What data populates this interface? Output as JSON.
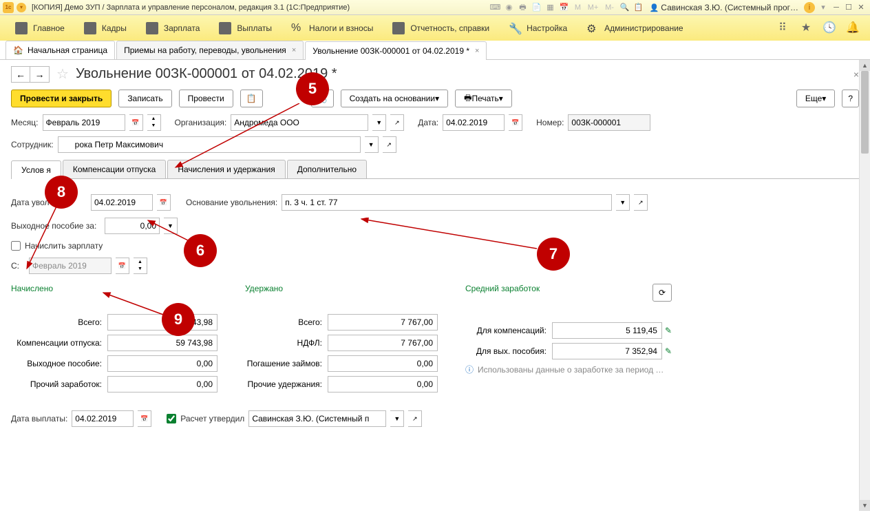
{
  "titlebar": {
    "title": "[КОПИЯ] Демо ЗУП / Зарплата и управление персоналом, редакция 3.1  (1С:Предприятие)",
    "user": "Савинская З.Ю. (Системный прог…",
    "m": "M",
    "mplus": "M+",
    "mminus": "M-"
  },
  "nav": {
    "items": [
      "Главное",
      "Кадры",
      "Зарплата",
      "Выплаты",
      "Налоги и взносы",
      "Отчетность, справки",
      "Настройка",
      "Администрирование"
    ]
  },
  "tabs": {
    "home": "Начальная страница",
    "t1": "Приемы на работу, переводы, увольнения",
    "t2": "Увольнение 00ЗК-000001 от 04.02.2019 *"
  },
  "page": {
    "title": "Увольнение 00ЗК-000001 от 04.02.2019 *"
  },
  "toolbar": {
    "post_close": "Провести и закрыть",
    "save": "Записать",
    "post": "Провести",
    "create_on": "Создать на основании",
    "print": "Печать",
    "more": "Еще"
  },
  "fields": {
    "month_lbl": "Месяц:",
    "month": "Февраль 2019",
    "org_lbl": "Организация:",
    "org": "Андромеда ООО",
    "date_lbl": "Дата:",
    "date": "04.02.2019",
    "num_lbl": "Номер:",
    "num": "00ЗК-000001",
    "emp_lbl": "Сотрудник:",
    "emp": "      рока Петр Максимович"
  },
  "dtabs": {
    "t1": "Услов               я",
    "t2": "Компенсации отпуска",
    "t3": "Начисления и удержания",
    "t4": "Дополнительно"
  },
  "panel": {
    "dismiss_date_lbl": "Дата увол         ия:",
    "dismiss_date": "04.02.2019",
    "reason_lbl": "Основание увольнения:",
    "reason": "п. 3 ч. 1 ст. 77",
    "sev_lbl": "Выходное пособие за:",
    "sev": "0,00",
    "accrue_lbl": "Начислить зарплату",
    "from_lbl": "С:",
    "from": "Февраль 2019"
  },
  "sections": {
    "accrued": "Начислено",
    "withheld": "Удержано",
    "avg": "Средний заработок"
  },
  "accrued": {
    "total_lbl": "Всего:",
    "total": "       43,98",
    "comp_lbl": "Компенсации отпуска:",
    "comp": "59 743,98",
    "sev_lbl": "Выходное пособие:",
    "sev": "0,00",
    "other_lbl": "Прочий заработок:",
    "other": "0,00"
  },
  "withheld": {
    "total_lbl": "Всего:",
    "total": "7 767,00",
    "ndfl_lbl": "НДФЛ:",
    "ndfl": "7 767,00",
    "loan_lbl": "Погашение займов:",
    "loan": "0,00",
    "other_lbl": "Прочие удержания:",
    "other": "0,00"
  },
  "avg": {
    "comp_lbl": "Для компенсаций:",
    "comp": "5 119,45",
    "sev_lbl": "Для вых. пособия:",
    "sev": "7 352,94",
    "info": "Использованы данные о заработке за период …"
  },
  "footer": {
    "paydate_lbl": "Дата выплаты:",
    "paydate": "04.02.2019",
    "approved_lbl": "Расчет утвердил",
    "approved": "Савинская З.Ю. (Системный п"
  },
  "callouts": {
    "c5": "5",
    "c6": "6",
    "c7": "7",
    "c8": "8",
    "c9": "9"
  }
}
